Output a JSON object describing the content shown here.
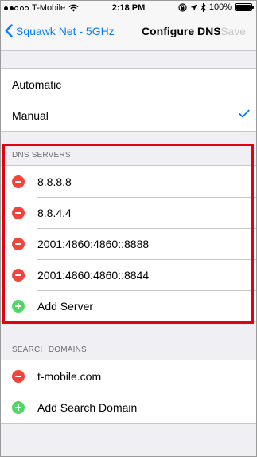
{
  "status_bar": {
    "carrier": "T-Mobile",
    "time": "2:18 PM",
    "battery": "100%"
  },
  "nav": {
    "back_label": "Squawk Net - 5GHz",
    "title": "Configure DNS",
    "save_label": "Save"
  },
  "mode": {
    "options": [
      "Automatic",
      "Manual"
    ],
    "selected": "Manual"
  },
  "dns_servers": {
    "header": "DNS SERVERS",
    "servers": [
      "8.8.8.8",
      "8.8.4.4",
      "2001:4860:4860::8888",
      "2001:4860:4860::8844"
    ],
    "add_label": "Add Server"
  },
  "search_domains": {
    "header": "SEARCH DOMAINS",
    "domains": [
      "t-mobile.com"
    ],
    "add_label": "Add Search Domain"
  },
  "colors": {
    "accent": "#0a7aff",
    "delete": "#f2443a",
    "add": "#4cd964",
    "highlight": "#e3000f"
  }
}
